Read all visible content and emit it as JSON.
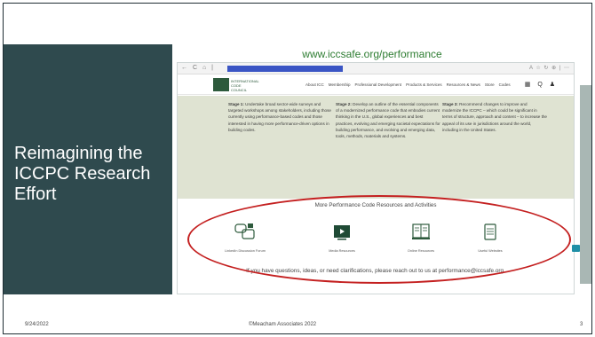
{
  "slide": {
    "title": "Reimagining the ICCPC Research Effort",
    "url_caption": "www.iccsafe.org/performance",
    "footer_date": "9/24/2022",
    "footer_copyright": "©Meacham Associates 2022",
    "page_number": "3"
  },
  "browser": {
    "nav_icons": "← C ⌂ |",
    "right_icons": "A ☆ ↻ ⊕ | ⋯"
  },
  "site": {
    "logo_text": "INTERNATIONAL CODE COUNCIL",
    "nav": [
      "About ICC",
      "Membership",
      "Professional Development",
      "Products & Services",
      "Resources & News",
      "Store",
      "Codes"
    ],
    "tools": "▦ Q ♟"
  },
  "stages": [
    {
      "label": "Stage 1:",
      "text": "Undertake broad sector-wide surveys and targeted workshops among stakeholders, including those currently using performance-based codes and those interested in having more performance-driven options in building codes."
    },
    {
      "label": "Stage 2:",
      "text": "Develop an outline of the essential components of a modernized performance code that embodies current thinking in the U.S., global experiences and best practices, evolving and emerging societal expectations for building performance, and evolving and emerging data, tools, methods, materials and systems."
    },
    {
      "label": "Stage 3:",
      "text": "Recommend changes to improve and modernize the ICCPC – which could be significant in terms of structure, approach and content – to increase the appeal of its use in jurisdictions around the world, including in the United States."
    }
  ],
  "resources": {
    "title": "More Performance Code Resources and Activities",
    "items": [
      {
        "label": "LinkedIn Discussion Forum",
        "icon": "chat-bubbles-icon"
      },
      {
        "label": "Media Resources",
        "icon": "media-play-icon"
      },
      {
        "label": "Online Resources",
        "icon": "open-book-icon"
      },
      {
        "label": "Useful Websites",
        "icon": "document-icon"
      }
    ],
    "contact": "If you have questions, ideas, or need clarifications, please reach out to us at performance@iccsafe.org."
  },
  "colors": {
    "panel": "#2f4a4e",
    "accent_green": "#2e7d32",
    "highlight": "#c42020",
    "stages_bg": "#dfe3d2"
  }
}
